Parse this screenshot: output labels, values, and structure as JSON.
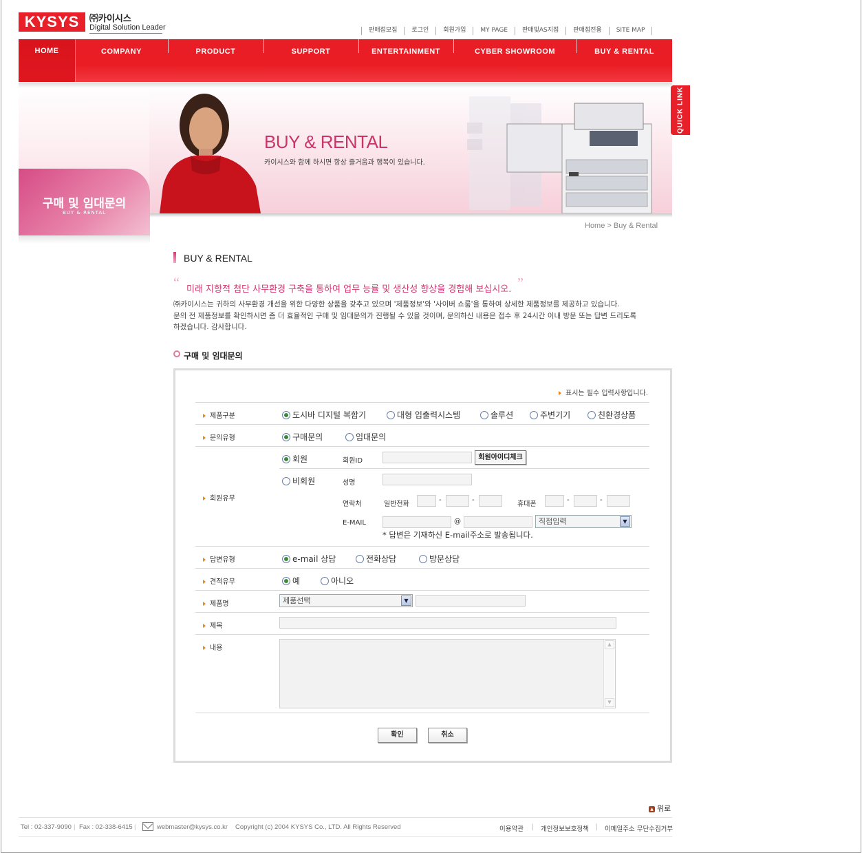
{
  "header": {
    "logo_text": "KYSYS",
    "logo_kr": "㈜카이시스",
    "logo_tagline": "Digital Solution Leader",
    "util_links": [
      "판매점모집",
      "로그인",
      "회원가입",
      "MY PAGE",
      "판매및AS지점",
      "판매점전용",
      "SITE MAP"
    ]
  },
  "nav": [
    "HOME",
    "COMPANY",
    "PRODUCT",
    "SUPPORT",
    "ENTERTAINMENT",
    "CYBER SHOWROOM",
    "BUY & RENTAL"
  ],
  "quick_link": "QUICK LINK",
  "banner": {
    "title": "BUY & RENTAL",
    "subtitle": "카이시스와 함께 하시면 항상 즐거움과 행복이 있습니다."
  },
  "side": {
    "title_kr": "구매 및 임대문의",
    "title_en": "BUY & RENTAL"
  },
  "breadcrumb": "Home > Buy & Rental",
  "section_title": "BUY & RENTAL",
  "slogan": "미래 지향적 첨단 사무환경 구축을 통하여 업무 능률 및 생산성 향상을 경험해 보십시오.",
  "intro": [
    "㈜카이시스는 귀하의 사무환경 개선을 위한 다양한 상품을 갖추고 있으며 '제품정보'와 '사이버 쇼룸'을 통하여 상세한 제품정보를 제공하고 있습니다.",
    "문의 전 제품정보를 확인하시면 좀 더 효율적인 구매 및 임대문의가 진행될 수 있을 것이며, 문의하신 내용은 접수 후 24시간 이내 방문 또는 답변 드리도록",
    "하겠습니다.  감사합니다."
  ],
  "form": {
    "title": "구매 및 임대문의",
    "required_note": "표시는 필수 입력사항입니다.",
    "labels": {
      "product_type": "제품구분",
      "inquiry_type": "문의유형",
      "membership": "회원유무",
      "answer_type": "답변유형",
      "estimate": "견적유무",
      "product_name": "제품명",
      "subject": "제목",
      "content": "내용"
    },
    "product_types": [
      "도시바 디지털 복합기",
      "대형 입출력시스템",
      "솔루션",
      "주변기기",
      "친환경상품"
    ],
    "inquiry_types": [
      "구매문의",
      "임대문의"
    ],
    "member": "회원",
    "member_id_label": "회원ID",
    "id_check_button": "회원아이디체크",
    "non_member": "비회원",
    "name_label": "성명",
    "contact_label": "연락처",
    "phone_label": "일반전화",
    "mobile_label": "휴대폰",
    "email_label": "E-MAIL",
    "at_sign": "@",
    "email_domain_select": "직접입력",
    "email_note": "* 답변은 기재하신 E-mail주소로 발송됩니다.",
    "answer_types": [
      "e-mail 상담",
      "전화상담",
      "방문상담"
    ],
    "estimate_options": [
      "예",
      "아니오"
    ],
    "product_select": "제품선택",
    "confirm_button": "확인",
    "cancel_button": "취소"
  },
  "footer": {
    "top_link": "위로",
    "tel": "Tel : 02-337-9090",
    "fax": "Fax : 02-338-6415",
    "email": "webmaster@kysys.co.kr",
    "copyright": "Copyright (c) 2004 KYSYS Co., LTD.  All Rights Reserved",
    "links": [
      "이용약관",
      "개인정보보호정책",
      "이메일주소 무단수집거부"
    ]
  },
  "colors": {
    "brand_red": "#e8202a",
    "accent_pink": "#d0366f",
    "arrow_orange": "#e8861c"
  }
}
